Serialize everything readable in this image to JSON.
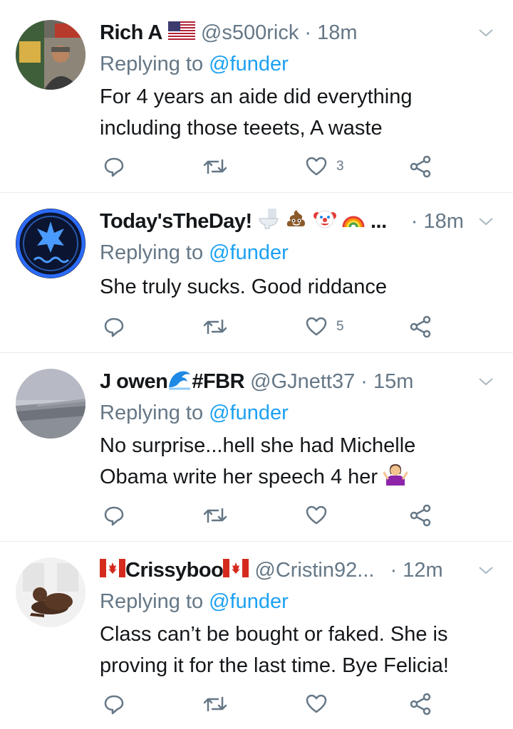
{
  "tweets": [
    {
      "name": "Rich A",
      "handle": "@s500rick",
      "dot": "·",
      "time": "18m",
      "replying_prefix": "Replying to",
      "replying_to": "@funder",
      "text_lines": [
        "For 4 years an aide did everything",
        "including those teeets, A waste"
      ],
      "like_count": "3",
      "avatar_icon": "photo-man-street",
      "name_emoji": [
        "flag-us-icon"
      ]
    },
    {
      "name": "Today'sTheDay!",
      "name_suffix": "...",
      "dot": "·",
      "time": "18m",
      "replying_prefix": "Replying to",
      "replying_to": "@funder",
      "text_lines": [
        "She truly sucks.  Good riddance"
      ],
      "like_count": "5",
      "avatar_icon": "rebel-alliance-logo",
      "name_emoji": [
        "toilet-icon",
        "poop-icon",
        "clown-icon",
        "rainbow-icon"
      ]
    },
    {
      "name": "J owen",
      "name_tag": "#FBR",
      "handle": "@GJnett37",
      "dot": "·",
      "time": "15m",
      "replying_prefix": "Replying to",
      "replying_to": "@funder",
      "text_lines": [
        "No surprise...hell she had Michelle",
        "Obama write her speech 4 her"
      ],
      "like_count": "",
      "avatar_icon": "photo-landscape-coast",
      "name_emoji": [
        "wave-icon"
      ],
      "text_emoji": [
        "person-shrugging-icon"
      ]
    },
    {
      "name": "Crissyboo",
      "handle": "@Cristin92...",
      "dot": "·",
      "time": "12m",
      "replying_prefix": "Replying to",
      "replying_to": "@funder",
      "text_lines": [
        "Class can’t be bought or faked. She is",
        "proving it for the last time. Bye Felicia!"
      ],
      "like_count": "",
      "avatar_icon": "photo-dog",
      "name_emoji": [
        "flag-canada-icon",
        "flag-canada-icon"
      ]
    }
  ],
  "colors": {
    "text": "#14171a",
    "secondary": "#657786",
    "link": "#1da1f2",
    "divider": "#e6ecf0"
  }
}
